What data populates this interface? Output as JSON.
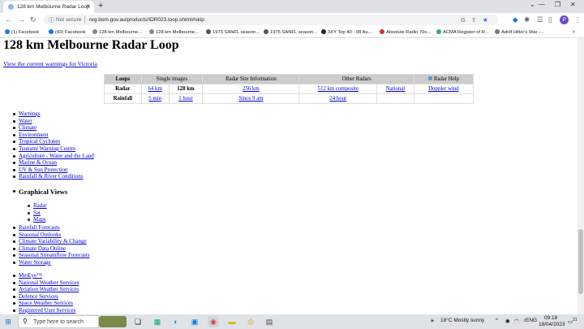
{
  "browser": {
    "tab_title": "128 km Melbourne Radar Loop",
    "new_tab": "+",
    "close_tab": "×",
    "not_secure": "Not secure",
    "url": "reg.bom.gov.au/products/IDR023.loop.shtml#skip",
    "profile_initial": "P",
    "bookmarks": [
      "(1) Facebook",
      "(43) Facebook",
      "128 km Melbourne...",
      "128 km Melbourne...",
      "1973 SANFL season...",
      "1975 SANFL season...",
      "3XY Top 40 - 08 Au...",
      "Absolute Radio 70s...",
      "ACMA Register of R...",
      "Adolf Hitler's War -..."
    ]
  },
  "page": {
    "title": "128 km Melbourne Radar Loop",
    "warnings_link": "View the current warnings for Victoria",
    "table": {
      "headers": [
        "Loops",
        "Single images",
        "Radar Site Information",
        "Other Radars",
        "Radar Help"
      ],
      "row1": {
        "label": "Radar",
        "c1": "64 km",
        "c2": "128 km",
        "c3": "256 km",
        "c4": "512 km composite",
        "c5": "National",
        "c6": "Doppler wind"
      },
      "row2": {
        "label": "Rainfall",
        "c1": "5 min",
        "c2": "1 hour",
        "c3": "Since 9 am",
        "c4": "24 hour"
      }
    },
    "nav_links": [
      "Warnings",
      "Water",
      "Climate",
      "Environment",
      "Tropical Cyclones",
      "Tsunami Warning Centre",
      "Agriculture - Water and the Land",
      "Marine & Ocean",
      "UV & Sun Protection",
      "Rainfall & River Conditions"
    ],
    "graphical_views_title": "Graphical Views",
    "graphical_views": [
      "Radar",
      "Sat",
      "Maps"
    ],
    "more_links": [
      "Rainfall Forecasts",
      "Seasonal Outlooks",
      "Climate Variability & Change",
      "Climate Data Online",
      "Seasonal Streamflow Forecasts",
      "Water Storage"
    ],
    "services_links": [
      "MetEye™",
      "National Weather Services",
      "Aviation Weather Services",
      "Defence Services",
      "Space Weather Services",
      "Registered User Services"
    ]
  },
  "taskbar": {
    "search_placeholder": "Type here to search",
    "weather": "18°C  Mostly sunny",
    "language": "ENG",
    "time": "09:18",
    "date": "18/04/2023",
    "notifications": "21"
  }
}
